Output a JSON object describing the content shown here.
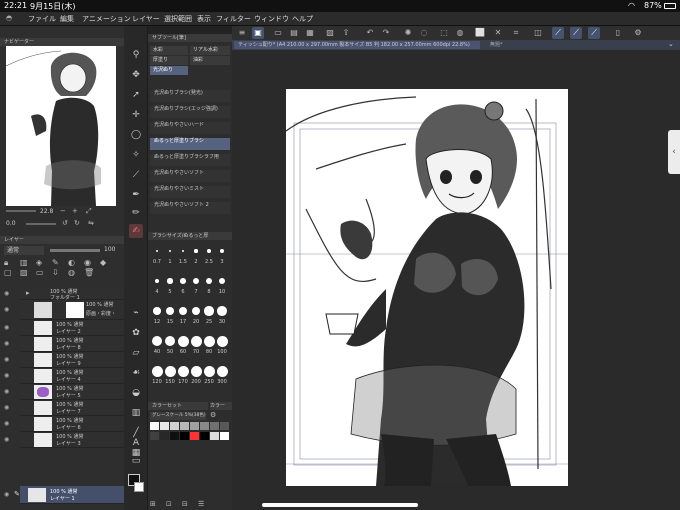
{
  "status": {
    "time": "22:21",
    "date": "9月15日(木)",
    "battery": "87%"
  },
  "menu": [
    "ファイル",
    "編集",
    "アニメーション",
    "レイヤー",
    "選択範囲",
    "表示",
    "フィルター",
    "ウィンドウ",
    "ヘルプ"
  ],
  "tab": {
    "label": "ティッシュ配り* (A4 210.00 x 297.00mm 製本サイズ B5 判 182.00 x 257.00mm 600dpi 22.8%)",
    "second": "無題*"
  },
  "navigator": {
    "title": "ナビゲーター",
    "zoom": "22.8",
    "rotate": "0.0"
  },
  "layers": {
    "title": "レイヤー",
    "blend": "通常",
    "opacity": "100",
    "items": [
      {
        "l1": "100 % 通常",
        "l2": "フォルダー 1"
      },
      {
        "l1": "100 % 通常",
        "l2": "原画・彩度・"
      },
      {
        "l1": "100 % 通常",
        "l2": "レイヤー 2"
      },
      {
        "l1": "100 % 通常",
        "l2": "レイヤー 8"
      },
      {
        "l1": "100 % 通常",
        "l2": "レイヤー 9"
      },
      {
        "l1": "100 % 通常",
        "l2": "レイヤー 4"
      },
      {
        "l1": "100 % 通常",
        "l2": "レイヤー 5"
      },
      {
        "l1": "100 % 通常",
        "l2": "レイヤー 7"
      },
      {
        "l1": "100 % 通常",
        "l2": "レイヤー 6"
      },
      {
        "l1": "100 % 通常",
        "l2": "レイヤー 3"
      },
      {
        "l1": "100 % 通常",
        "l2": "レイヤー 1"
      }
    ]
  },
  "subtool": {
    "title": "サブツール[筆]",
    "tabs": [
      "水彩",
      "リアル水彩",
      "厚塗り",
      "油彩",
      "光沢ぬり"
    ],
    "items": [
      "光沢ぬりブラシ(発光)",
      "光沢ぬりブラシ(エッジ強調)",
      "光沢ぬりやさいハード",
      "ぬるっと厚塗りブラシ",
      "ぬるっと厚塗りブラシラフ用",
      "光沢ぬりやさいソフト",
      "光沢ぬりやさいミスト",
      "光沢ぬりやさいソフト 2"
    ]
  },
  "brushsize": {
    "title": "ブラシサイズ/ぬるっと厚",
    "sizes": [
      "0.7",
      "1",
      "1.5",
      "2",
      "2.5",
      "3",
      "4",
      "5",
      "6",
      "7",
      "8",
      "10",
      "12",
      "15",
      "17",
      "20",
      "25",
      "30",
      "40",
      "50",
      "60",
      "70",
      "80",
      "100",
      "120",
      "150",
      "170",
      "200",
      "250",
      "300",
      "400",
      "500",
      "600",
      "700",
      "800",
      "1000"
    ]
  },
  "color": {
    "title": "カラーセット",
    "tab2": "カラー",
    "setname": "グレースケール 5%(38色)",
    "swatches": [
      "#ffffff",
      "#e8e8e8",
      "#d0d0d0",
      "#b8b8b8",
      "#a0a0a0",
      "#888888",
      "#707070",
      "#585858",
      "#404040",
      "#282828",
      "#101010",
      "#000000",
      "#ff3333",
      "#000000",
      "#dddddd",
      "#ffffff"
    ]
  }
}
